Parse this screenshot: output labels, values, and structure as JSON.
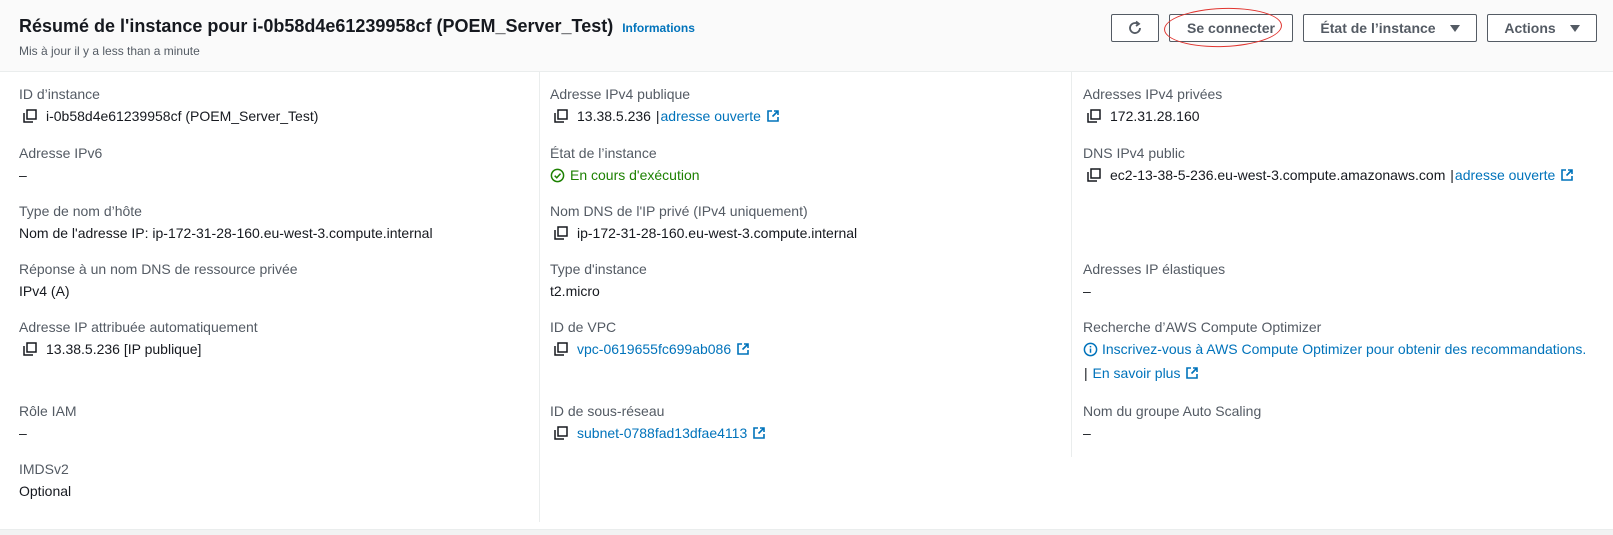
{
  "header": {
    "title": "Résumé de l'instance pour i-0b58d4e61239958cf (POEM_Server_Test)",
    "info_link": "Informations",
    "updated": "Mis à jour il y a less than a minute",
    "buttons": {
      "refresh_icon": "refresh-icon",
      "connect": "Se connecter",
      "instance_state": "État de l’instance",
      "actions": "Actions"
    }
  },
  "col1": {
    "instance_id_label": "ID d’instance",
    "instance_id_value": "i-0b58d4e61239958cf (POEM_Server_Test)",
    "ipv6_label": "Adresse IPv6",
    "ipv6_value": "–",
    "hostname_type_label": "Type de nom d’hôte",
    "hostname_type_value": "Nom de l'adresse IP: ip-172-31-28-160.eu-west-3.compute.internal",
    "dns_response_label": "Réponse à un nom DNS de ressource privée",
    "dns_response_value": "IPv4 (A)",
    "auto_ip_label": "Adresse IP attribuée automatiquement",
    "auto_ip_value": "13.38.5.236 [IP publique]",
    "iam_label": "Rôle IAM",
    "iam_value": "–",
    "imds_label": "IMDSv2",
    "imds_value": "Optional"
  },
  "col2": {
    "public_ipv4_label": "Adresse IPv4 publique",
    "public_ipv4_value": "13.38.5.236",
    "open_address": "adresse ouverte",
    "state_label": "État de l’instance",
    "state_value": "En cours d'exécution",
    "private_dns_label": "Nom DNS de l'IP privé (IPv4 uniquement)",
    "private_dns_value": "ip-172-31-28-160.eu-west-3.compute.internal",
    "instance_type_label": "Type d'instance",
    "instance_type_value": "t2.micro",
    "vpc_label": "ID de VPC",
    "vpc_value": "vpc-0619655fc699ab086",
    "subnet_label": "ID de sous-réseau",
    "subnet_value": "subnet-0788fad13dfae4113"
  },
  "col3": {
    "private_ipv4_label": "Adresses IPv4 privées",
    "private_ipv4_value": "172.31.28.160",
    "public_dns_label": "DNS IPv4 public",
    "public_dns_value": "ec2-13-38-5-236.eu-west-3.compute.amazonaws.com",
    "open_address": "adresse ouverte",
    "elastic_ip_label": "Adresses IP élastiques",
    "elastic_ip_value": "–",
    "optimizer_label": "Recherche d’AWS Compute Optimizer",
    "optimizer_link": "Inscrivez-vous à AWS Compute Optimizer pour obtenir des recommandations.",
    "learn_more": "En savoir plus",
    "asg_label": "Nom du groupe Auto Scaling",
    "asg_value": "–"
  },
  "colors": {
    "link": "#0073bb",
    "running": "#1d8102",
    "annotation": "#e0342f"
  }
}
